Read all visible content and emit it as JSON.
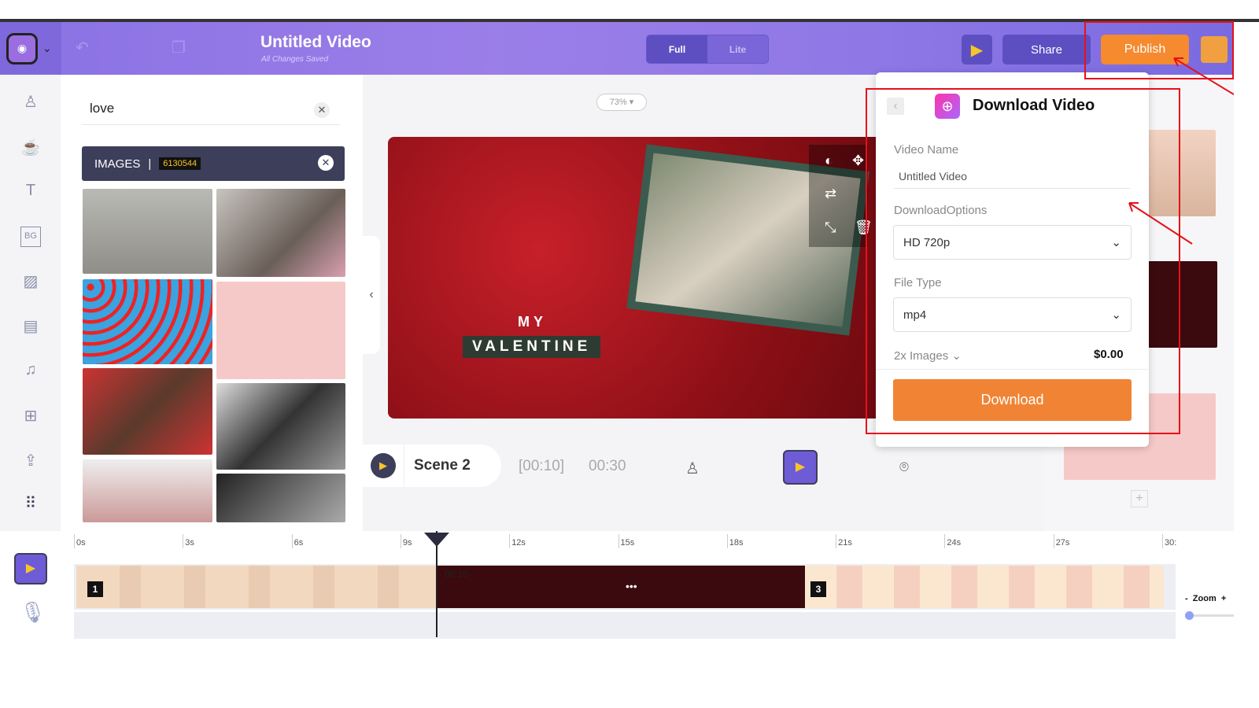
{
  "header": {
    "title": "Untitled Video",
    "subtitle": "All Changes Saved",
    "mode_full": "Full",
    "mode_lite": "Lite",
    "share": "Share",
    "publish": "Publish"
  },
  "search": {
    "query": "love",
    "category": "IMAGES",
    "separator": "|",
    "count": "6130544"
  },
  "canvas": {
    "zoom": "73%",
    "text_line1": "MY",
    "text_line2": "VALENTINE"
  },
  "scene": {
    "name": "Scene 2",
    "start": "[00:10]",
    "duration": "00:30"
  },
  "download": {
    "title": "Download Video",
    "video_name_label": "Video Name",
    "video_name": "Untitled Video",
    "options_label": "DownloadOptions",
    "option": "HD 720p",
    "file_type_label": "File Type",
    "file_type": "mp4",
    "images_label": "2x Images",
    "price": "$0.00",
    "button": "Download"
  },
  "timeline": {
    "ticks": [
      "0s",
      "3s",
      "6s",
      "9s",
      "12s",
      "15s",
      "18s",
      "21s",
      "24s",
      "27s",
      "30:"
    ],
    "scenes": [
      "1",
      "3"
    ],
    "segment_time": "00:10",
    "more": "•••",
    "zoom_label": "Zoom",
    "zoom_minus": "-",
    "zoom_plus": "+"
  },
  "colors": {
    "header": "#8f78e6",
    "publish": "#f58a2e",
    "download": "#f08434",
    "annotation": "#e8101a"
  }
}
